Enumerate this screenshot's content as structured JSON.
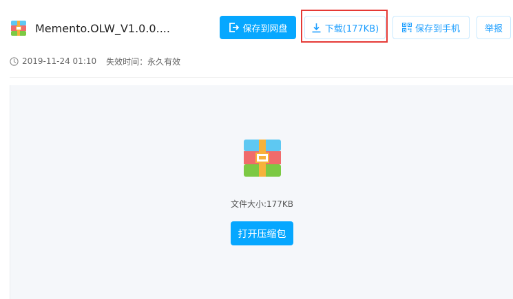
{
  "file": {
    "icon": "zip-archive-icon",
    "name": "Memento.OLW_V1.0.0...."
  },
  "actions": {
    "save_to_netdisk": "保存到网盘",
    "download": "下载(177KB)",
    "save_to_phone": "保存到手机",
    "report": "举报"
  },
  "meta": {
    "timestamp": "2019-11-24 01:10",
    "expiry": "失效时间：永久有效"
  },
  "preview": {
    "size_text": "文件大小:177KB",
    "open_button": "打开压缩包"
  },
  "colors": {
    "primary": "#06a7ff",
    "highlight": "#e53935",
    "preview_bg": "#f5f7fa"
  }
}
